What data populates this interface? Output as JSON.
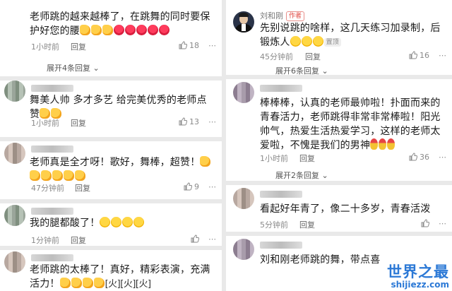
{
  "left": {
    "comments": [
      {
        "text_before": "老师跳的越来越棒了，在跳舞的同时要保护好您的腰",
        "emojis": [
          "thumb",
          "thumb",
          "thumb",
          "rose",
          "rose",
          "rose",
          "rose",
          "rose"
        ],
        "time": "1小时前",
        "reply": "回复",
        "likes": "18",
        "expand": "展开4条回复"
      },
      {
        "text_before": "舞美人帅 多才多艺 给完美优秀的老师点赞",
        "emojis": [
          "thumb",
          "thumb"
        ],
        "time": "1小时前",
        "reply": "回复",
        "likes": "13"
      },
      {
        "text_before": "老师真是全才呀！歌好，舞棒，超赞！",
        "emojis": [
          "thumb",
          "thumb",
          "thumb",
          "thumb",
          "thumb",
          "thumb"
        ],
        "time": "47分钟前",
        "reply": "回复",
        "likes": "9"
      },
      {
        "text_before": "我的腿都酸了！",
        "emojis": [
          "laugh",
          "laugh",
          "laugh",
          "laugh"
        ],
        "time": "1分钟前",
        "reply": "回复",
        "likes": ""
      },
      {
        "text_before": "老师跳的太棒了！真好，精彩表演，充满活力！",
        "emojis": [
          "thumb",
          "thumb",
          "thumb",
          "thumb"
        ],
        "fire_text": "[火][火][火]"
      }
    ]
  },
  "right": {
    "comments": [
      {
        "username": "刘和刚",
        "author_badge": "作者",
        "text": "先别说跳的啥样，这几天练习加录制，后锻炼人",
        "emojis": [
          "laugh",
          "laugh",
          "laugh"
        ],
        "pin_badge": "置顶",
        "time": "45分钟前",
        "reply": "回复",
        "likes": "16",
        "expand": "展开6条回复"
      },
      {
        "text": "棒棒棒，认真的老师最帅啦！扑面而来的青春活力，老师跳得非常非常棒啦！阳光帅气，热爱生活热爱学习，这样的老师太爱啦，不愧是我们的男神",
        "emojis": [
          "medal",
          "medal",
          "medal"
        ],
        "time": "1小时前",
        "reply": "回复",
        "likes": "36",
        "expand": "展开2条回复"
      },
      {
        "text": "看起好年青了，像二十多岁，青春活泼",
        "time": "5分钟前",
        "reply": "回复",
        "likes": ""
      },
      {
        "text": "刘和刚老师跳的舞，带点喜"
      }
    ]
  },
  "watermark": {
    "cn": "世界之最",
    "en": "shijiezz.com"
  }
}
